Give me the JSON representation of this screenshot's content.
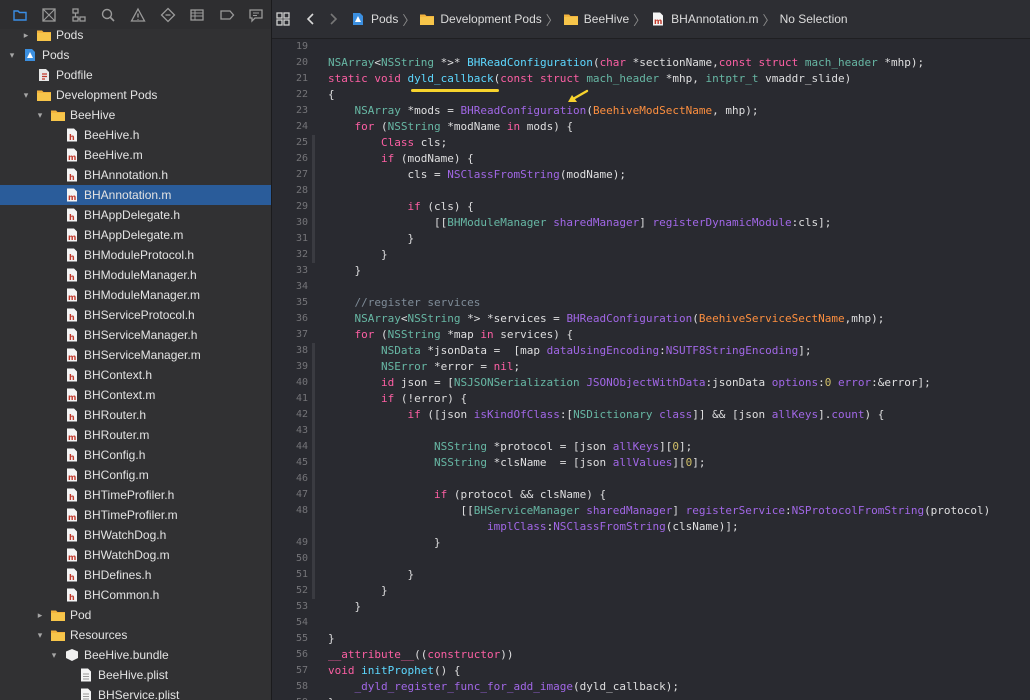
{
  "navigator": {
    "toolbar_icons": [
      "folder-icon",
      "source-control-icon",
      "symbol-icon",
      "find-icon",
      "issue-icon",
      "test-icon",
      "debug-icon",
      "breakpoint-icon",
      "report-icon"
    ],
    "items": [
      {
        "label": "Pods",
        "depth": 1,
        "kind": "folder",
        "disclosure": "▸"
      },
      {
        "label": "Pods",
        "depth": 0,
        "kind": "project",
        "disclosure": "▾"
      },
      {
        "label": "Podfile",
        "depth": 1,
        "kind": "podfile",
        "disclosure": ""
      },
      {
        "label": "Development Pods",
        "depth": 1,
        "kind": "folder",
        "disclosure": "▾"
      },
      {
        "label": "BeeHive",
        "depth": 2,
        "kind": "folder",
        "disclosure": "▾"
      },
      {
        "label": "BeeHive.h",
        "depth": 3,
        "kind": "file-h",
        "disclosure": ""
      },
      {
        "label": "BeeHive.m",
        "depth": 3,
        "kind": "file-m",
        "disclosure": ""
      },
      {
        "label": "BHAnnotation.h",
        "depth": 3,
        "kind": "file-h",
        "disclosure": ""
      },
      {
        "label": "BHAnnotation.m",
        "depth": 3,
        "kind": "file-m",
        "disclosure": "",
        "selected": true
      },
      {
        "label": "BHAppDelegate.h",
        "depth": 3,
        "kind": "file-h",
        "disclosure": ""
      },
      {
        "label": "BHAppDelegate.m",
        "depth": 3,
        "kind": "file-m",
        "disclosure": ""
      },
      {
        "label": "BHModuleProtocol.h",
        "depth": 3,
        "kind": "file-h",
        "disclosure": ""
      },
      {
        "label": "BHModuleManager.h",
        "depth": 3,
        "kind": "file-h",
        "disclosure": ""
      },
      {
        "label": "BHModuleManager.m",
        "depth": 3,
        "kind": "file-m",
        "disclosure": ""
      },
      {
        "label": "BHServiceProtocol.h",
        "depth": 3,
        "kind": "file-h",
        "disclosure": ""
      },
      {
        "label": "BHServiceManager.h",
        "depth": 3,
        "kind": "file-h",
        "disclosure": ""
      },
      {
        "label": "BHServiceManager.m",
        "depth": 3,
        "kind": "file-m",
        "disclosure": ""
      },
      {
        "label": "BHContext.h",
        "depth": 3,
        "kind": "file-h",
        "disclosure": ""
      },
      {
        "label": "BHContext.m",
        "depth": 3,
        "kind": "file-m",
        "disclosure": ""
      },
      {
        "label": "BHRouter.h",
        "depth": 3,
        "kind": "file-h",
        "disclosure": ""
      },
      {
        "label": "BHRouter.m",
        "depth": 3,
        "kind": "file-m",
        "disclosure": ""
      },
      {
        "label": "BHConfig.h",
        "depth": 3,
        "kind": "file-h",
        "disclosure": ""
      },
      {
        "label": "BHConfig.m",
        "depth": 3,
        "kind": "file-m",
        "disclosure": ""
      },
      {
        "label": "BHTimeProfiler.h",
        "depth": 3,
        "kind": "file-h",
        "disclosure": ""
      },
      {
        "label": "BHTimeProfiler.m",
        "depth": 3,
        "kind": "file-m",
        "disclosure": ""
      },
      {
        "label": "BHWatchDog.h",
        "depth": 3,
        "kind": "file-h",
        "disclosure": ""
      },
      {
        "label": "BHWatchDog.m",
        "depth": 3,
        "kind": "file-m",
        "disclosure": ""
      },
      {
        "label": "BHDefines.h",
        "depth": 3,
        "kind": "file-h",
        "disclosure": ""
      },
      {
        "label": "BHCommon.h",
        "depth": 3,
        "kind": "file-h",
        "disclosure": ""
      },
      {
        "label": "Pod",
        "depth": 2,
        "kind": "folder",
        "disclosure": "▸"
      },
      {
        "label": "Resources",
        "depth": 2,
        "kind": "folder",
        "disclosure": "▾"
      },
      {
        "label": "BeeHive.bundle",
        "depth": 3,
        "kind": "bundle",
        "disclosure": "▾"
      },
      {
        "label": "BeeHive.plist",
        "depth": 4,
        "kind": "plist",
        "disclosure": ""
      },
      {
        "label": "BHService.plist",
        "depth": 4,
        "kind": "plist",
        "disclosure": ""
      }
    ]
  },
  "jumpbar": {
    "crumbs": [
      {
        "label": "Pods",
        "icon": "project-icon"
      },
      {
        "label": "Development Pods",
        "icon": "folder-icon"
      },
      {
        "label": "BeeHive",
        "icon": "folder-icon"
      },
      {
        "label": "BHAnnotation.m",
        "icon": "objc-file-icon"
      },
      {
        "label": "No Selection",
        "icon": ""
      }
    ]
  },
  "editor": {
    "lines": [
      {
        "n": "19",
        "t": [],
        "fold": false
      },
      {
        "n": "20",
        "t": [
          [
            "ty",
            "NSArray"
          ],
          [
            "pl",
            "<"
          ],
          [
            "ty",
            "NSString"
          ],
          [
            "pl",
            " *>* "
          ],
          [
            "id",
            "BHReadConfiguration"
          ],
          [
            "pl",
            "("
          ],
          [
            "kw",
            "char"
          ],
          [
            "pl",
            " *sectionName,"
          ],
          [
            "kw",
            "const struct"
          ],
          [
            "pl",
            " "
          ],
          [
            "ty",
            "mach_header"
          ],
          [
            "pl",
            " *mhp);"
          ]
        ],
        "fold": false
      },
      {
        "n": "21",
        "t": [
          [
            "kw",
            "static void"
          ],
          [
            "pl",
            " "
          ],
          [
            "id",
            "dyld_callback"
          ],
          [
            "pl",
            "("
          ],
          [
            "kw",
            "const struct"
          ],
          [
            "pl",
            " "
          ],
          [
            "ty",
            "mach_header"
          ],
          [
            "pl",
            " *mhp, "
          ],
          [
            "ty",
            "intptr_t"
          ],
          [
            "pl",
            " vmaddr_slide)"
          ]
        ],
        "fold": false
      },
      {
        "n": "22",
        "t": [
          [
            "pl",
            "{"
          ]
        ],
        "fold": false
      },
      {
        "n": "23",
        "t": [
          [
            "pl",
            "    "
          ],
          [
            "ty",
            "NSArray"
          ],
          [
            "pl",
            " *mods = "
          ],
          [
            "fn",
            "BHReadConfiguration"
          ],
          [
            "pl",
            "("
          ],
          [
            "mc",
            "BeehiveModSectName"
          ],
          [
            "pl",
            ", mhp);"
          ]
        ],
        "fold": false
      },
      {
        "n": "24",
        "t": [
          [
            "pl",
            "    "
          ],
          [
            "kw",
            "for"
          ],
          [
            "pl",
            " ("
          ],
          [
            "ty",
            "NSString"
          ],
          [
            "pl",
            " *modName "
          ],
          [
            "kw",
            "in"
          ],
          [
            "pl",
            " mods) {"
          ]
        ],
        "fold": false
      },
      {
        "n": "25",
        "t": [
          [
            "pl",
            "        "
          ],
          [
            "kw",
            "Class"
          ],
          [
            "pl",
            " cls;"
          ]
        ],
        "fold": true
      },
      {
        "n": "26",
        "t": [
          [
            "pl",
            "        "
          ],
          [
            "kw",
            "if"
          ],
          [
            "pl",
            " (modName) {"
          ]
        ],
        "fold": true
      },
      {
        "n": "27",
        "t": [
          [
            "pl",
            "            cls = "
          ],
          [
            "fn",
            "NSClassFromString"
          ],
          [
            "pl",
            "(modName);"
          ]
        ],
        "fold": true
      },
      {
        "n": "28",
        "t": [],
        "fold": true
      },
      {
        "n": "29",
        "t": [
          [
            "pl",
            "            "
          ],
          [
            "kw",
            "if"
          ],
          [
            "pl",
            " (cls) {"
          ]
        ],
        "fold": true
      },
      {
        "n": "30",
        "t": [
          [
            "pl",
            "                [["
          ],
          [
            "ty",
            "BHModuleManager"
          ],
          [
            "pl",
            " "
          ],
          [
            "fn",
            "sharedManager"
          ],
          [
            "pl",
            "] "
          ],
          [
            "fn",
            "registerDynamicModule"
          ],
          [
            "pl",
            ":cls];"
          ]
        ],
        "fold": true
      },
      {
        "n": "31",
        "t": [
          [
            "pl",
            "            }"
          ]
        ],
        "fold": true
      },
      {
        "n": "32",
        "t": [
          [
            "pl",
            "        }"
          ]
        ],
        "fold": true
      },
      {
        "n": "33",
        "t": [
          [
            "pl",
            "    }"
          ]
        ],
        "fold": false
      },
      {
        "n": "34",
        "t": [],
        "fold": false
      },
      {
        "n": "35",
        "t": [
          [
            "pl",
            "    "
          ],
          [
            "cm",
            "//register services"
          ]
        ],
        "fold": false
      },
      {
        "n": "36",
        "t": [
          [
            "pl",
            "    "
          ],
          [
            "ty",
            "NSArray"
          ],
          [
            "pl",
            "<"
          ],
          [
            "ty",
            "NSString"
          ],
          [
            "pl",
            " *> *services = "
          ],
          [
            "fn",
            "BHReadConfiguration"
          ],
          [
            "pl",
            "("
          ],
          [
            "mc",
            "BeehiveServiceSectName"
          ],
          [
            "pl",
            ",mhp);"
          ]
        ],
        "fold": false
      },
      {
        "n": "37",
        "t": [
          [
            "pl",
            "    "
          ],
          [
            "kw",
            "for"
          ],
          [
            "pl",
            " ("
          ],
          [
            "ty",
            "NSString"
          ],
          [
            "pl",
            " *map "
          ],
          [
            "kw",
            "in"
          ],
          [
            "pl",
            " services) {"
          ]
        ],
        "fold": false
      },
      {
        "n": "38",
        "t": [
          [
            "pl",
            "        "
          ],
          [
            "ty",
            "NSData"
          ],
          [
            "pl",
            " *jsonData =  [map "
          ],
          [
            "fn",
            "dataUsingEncoding"
          ],
          [
            "pl",
            ":"
          ],
          [
            "fn",
            "NSUTF8StringEncoding"
          ],
          [
            "pl",
            "];"
          ]
        ],
        "fold": true
      },
      {
        "n": "39",
        "t": [
          [
            "pl",
            "        "
          ],
          [
            "ty",
            "NSError"
          ],
          [
            "pl",
            " *error = "
          ],
          [
            "kw",
            "nil"
          ],
          [
            "pl",
            ";"
          ]
        ],
        "fold": true
      },
      {
        "n": "40",
        "t": [
          [
            "pl",
            "        "
          ],
          [
            "kw",
            "id"
          ],
          [
            "pl",
            " json = ["
          ],
          [
            "ty",
            "NSJSONSerialization"
          ],
          [
            "pl",
            " "
          ],
          [
            "fn",
            "JSONObjectWithData"
          ],
          [
            "pl",
            ":jsonData "
          ],
          [
            "fn",
            "options"
          ],
          [
            "pl",
            ":"
          ],
          [
            "nu",
            "0"
          ],
          [
            "pl",
            " "
          ],
          [
            "fn",
            "error"
          ],
          [
            "pl",
            ":&error];"
          ]
        ],
        "fold": true
      },
      {
        "n": "41",
        "t": [
          [
            "pl",
            "        "
          ],
          [
            "kw",
            "if"
          ],
          [
            "pl",
            " (!error) {"
          ]
        ],
        "fold": true
      },
      {
        "n": "42",
        "t": [
          [
            "pl",
            "            "
          ],
          [
            "kw",
            "if"
          ],
          [
            "pl",
            " ([json "
          ],
          [
            "fn",
            "isKindOfClass"
          ],
          [
            "pl",
            ":["
          ],
          [
            "ty",
            "NSDictionary"
          ],
          [
            "pl",
            " "
          ],
          [
            "fn",
            "class"
          ],
          [
            "pl",
            "]] && [json "
          ],
          [
            "fn",
            "allKeys"
          ],
          [
            "pl",
            "]."
          ],
          [
            "fn",
            "count"
          ],
          [
            "pl",
            ") {"
          ]
        ],
        "fold": true
      },
      {
        "n": "43",
        "t": [],
        "fold": true
      },
      {
        "n": "44",
        "t": [
          [
            "pl",
            "                "
          ],
          [
            "ty",
            "NSString"
          ],
          [
            "pl",
            " *protocol = [json "
          ],
          [
            "fn",
            "allKeys"
          ],
          [
            "pl",
            "]["
          ],
          [
            "nu",
            "0"
          ],
          [
            "pl",
            "];"
          ]
        ],
        "fold": true
      },
      {
        "n": "45",
        "t": [
          [
            "pl",
            "                "
          ],
          [
            "ty",
            "NSString"
          ],
          [
            "pl",
            " *clsName  = [json "
          ],
          [
            "fn",
            "allValues"
          ],
          [
            "pl",
            "]["
          ],
          [
            "nu",
            "0"
          ],
          [
            "pl",
            "];"
          ]
        ],
        "fold": true
      },
      {
        "n": "46",
        "t": [],
        "fold": true
      },
      {
        "n": "47",
        "t": [
          [
            "pl",
            "                "
          ],
          [
            "kw",
            "if"
          ],
          [
            "pl",
            " (protocol && clsName) {"
          ]
        ],
        "fold": true
      },
      {
        "n": "48",
        "t": [
          [
            "pl",
            "                    [["
          ],
          [
            "ty",
            "BHServiceManager"
          ],
          [
            "pl",
            " "
          ],
          [
            "fn",
            "sharedManager"
          ],
          [
            "pl",
            "] "
          ],
          [
            "fn",
            "registerService"
          ],
          [
            "pl",
            ":"
          ],
          [
            "fn",
            "NSProtocolFromString"
          ],
          [
            "pl",
            "(protocol)"
          ]
        ],
        "fold": true
      },
      {
        "n": "",
        "t": [
          [
            "pl",
            "                        "
          ],
          [
            "fn",
            "implClass"
          ],
          [
            "pl",
            ":"
          ],
          [
            "fn",
            "NSClassFromString"
          ],
          [
            "pl",
            "(clsName)];"
          ]
        ],
        "fold": true
      },
      {
        "n": "49",
        "t": [
          [
            "pl",
            "                }"
          ]
        ],
        "fold": true
      },
      {
        "n": "50",
        "t": [],
        "fold": true
      },
      {
        "n": "51",
        "t": [
          [
            "pl",
            "            }"
          ]
        ],
        "fold": true
      },
      {
        "n": "52",
        "t": [
          [
            "pl",
            "        }"
          ]
        ],
        "fold": true
      },
      {
        "n": "53",
        "t": [
          [
            "pl",
            "    }"
          ]
        ],
        "fold": false
      },
      {
        "n": "54",
        "t": [],
        "fold": false
      },
      {
        "n": "55",
        "t": [
          [
            "pl",
            "}"
          ]
        ],
        "fold": false
      },
      {
        "n": "56",
        "t": [
          [
            "kw",
            "__attribute__"
          ],
          [
            "pl",
            "(("
          ],
          [
            "kw",
            "constructor"
          ],
          [
            "pl",
            "))"
          ]
        ],
        "fold": false
      },
      {
        "n": "57",
        "t": [
          [
            "kw",
            "void"
          ],
          [
            "pl",
            " "
          ],
          [
            "id",
            "initProphet"
          ],
          [
            "pl",
            "() {"
          ]
        ],
        "fold": false
      },
      {
        "n": "58",
        "t": [
          [
            "pl",
            "    "
          ],
          [
            "fn",
            "_dyld_register_func_for_add_image"
          ],
          [
            "pl",
            "(dyld_callback);"
          ]
        ],
        "fold": false
      },
      {
        "n": "59",
        "t": [
          [
            "pl",
            "}"
          ]
        ],
        "fold": false
      }
    ]
  },
  "colors": {
    "keyword": "#fc5fa3",
    "type": "#67b7a4",
    "function": "#a167e6",
    "macro": "#fd8f3f",
    "comment": "#7f8c98",
    "identifier": "#5dd8ff",
    "selection": "#2a5c9a",
    "annotation": "#f7d32d"
  }
}
